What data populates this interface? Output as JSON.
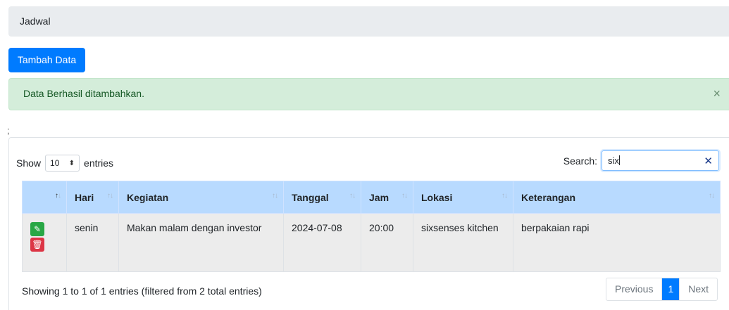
{
  "breadcrumb": {
    "label": "Jadwal"
  },
  "toolbar": {
    "add_label": "Tambah Data"
  },
  "alert": {
    "message": "Data Berhasil ditambahkan.",
    "close_glyph": "×"
  },
  "stray_text": ";",
  "table_controls": {
    "show_label": "Show",
    "length_value": "10",
    "entries_label": "entries",
    "search_label": "Search:",
    "search_value": "six"
  },
  "table": {
    "columns": [
      "",
      "Hari",
      "Kegiatan",
      "Tanggal",
      "Jam",
      "Lokasi",
      "Keterangan"
    ],
    "rows": [
      {
        "hari": "senin",
        "kegiatan": "Makan malam dengan investor",
        "tanggal": "2024-07-08",
        "jam": "20:00",
        "lokasi": "sixsenses kitchen",
        "keterangan": "berpakaian rapi"
      }
    ]
  },
  "footer": {
    "info": "Showing 1 to 1 of 1 entries (filtered from 2 total entries)",
    "prev_label": "Previous",
    "current_page": "1",
    "next_label": "Next"
  },
  "colors": {
    "primary": "#007bff",
    "success_bg": "#d4edda",
    "header_bg": "#b8daff",
    "edit": "#28a745",
    "delete": "#dc3545"
  }
}
